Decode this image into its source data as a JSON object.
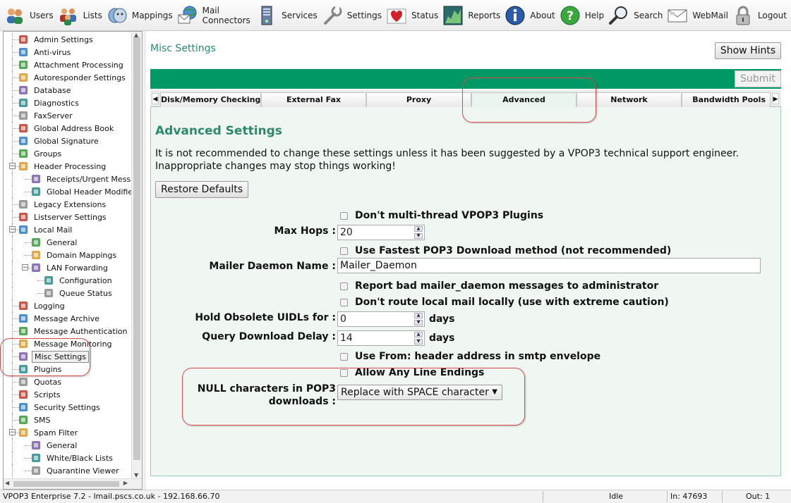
{
  "toolbar": {
    "items": [
      {
        "label": "Users",
        "icon": "users-icon"
      },
      {
        "label": "Lists",
        "icon": "lists-icon"
      },
      {
        "label": "Mappings",
        "icon": "mappings-icon"
      },
      {
        "label": "Mail Connectors",
        "icon": "mail-connectors-icon"
      },
      {
        "label": "Services",
        "icon": "services-icon"
      },
      {
        "label": "Settings",
        "icon": "settings-icon"
      },
      {
        "label": "Status",
        "icon": "status-icon"
      },
      {
        "label": "Reports",
        "icon": "reports-icon"
      },
      {
        "label": "About",
        "icon": "about-icon"
      },
      {
        "label": "Help",
        "icon": "help-icon"
      },
      {
        "label": "Search",
        "icon": "search-icon"
      },
      {
        "label": "WebMail",
        "icon": "webmail-icon"
      },
      {
        "label": "Logout",
        "icon": "logout-icon"
      }
    ]
  },
  "sidebar": {
    "items": [
      {
        "label": "Admin Settings",
        "icon": "admin-icon"
      },
      {
        "label": "Anti-virus",
        "icon": "shield-icon"
      },
      {
        "label": "Attachment Processing",
        "icon": "paperclip-icon"
      },
      {
        "label": "Autoresponder Settings",
        "icon": "autoresponder-icon"
      },
      {
        "label": "Database",
        "icon": "database-icon"
      },
      {
        "label": "Diagnostics",
        "icon": "diagnostics-icon"
      },
      {
        "label": "FaxServer",
        "icon": "fax-icon"
      },
      {
        "label": "Global Address Book",
        "icon": "address-book-icon"
      },
      {
        "label": "Global Signature",
        "icon": "signature-icon"
      },
      {
        "label": "Groups",
        "icon": "groups-icon"
      },
      {
        "label": "Header Processing",
        "icon": "header-icon"
      },
      {
        "label": "Receipts/Urgent Messages",
        "icon": "receipt-icon"
      },
      {
        "label": "Global Header Modifiers",
        "icon": "modifier-icon"
      },
      {
        "label": "Legacy Extensions",
        "icon": "puzzle-icon"
      },
      {
        "label": "Listserver Settings",
        "icon": "listserver-icon"
      },
      {
        "label": "Local Mail",
        "icon": "local-mail-icon"
      },
      {
        "label": "General",
        "icon": "gear-globe-icon"
      },
      {
        "label": "Domain Mappings",
        "icon": "globe-icon"
      },
      {
        "label": "LAN Forwarding",
        "icon": "lan-icon"
      },
      {
        "label": "Configuration",
        "icon": "config-icon"
      },
      {
        "label": "Queue Status",
        "icon": "queue-icon"
      },
      {
        "label": "Logging",
        "icon": "logging-icon"
      },
      {
        "label": "Message Archive",
        "icon": "archive-icon"
      },
      {
        "label": "Message Authentication",
        "icon": "auth-icon"
      },
      {
        "label": "Message Monitoring",
        "icon": "monitor-icon"
      },
      {
        "label": "Misc Settings",
        "icon": "wrench-icon"
      },
      {
        "label": "Plugins",
        "icon": "plugin-icon"
      },
      {
        "label": "Quotas",
        "icon": "quota-icon"
      },
      {
        "label": "Scripts",
        "icon": "script-icon"
      },
      {
        "label": "Security Settings",
        "icon": "security-icon"
      },
      {
        "label": "SMS",
        "icon": "phone-icon"
      },
      {
        "label": "Spam Filter",
        "icon": "spam-icon"
      },
      {
        "label": "General",
        "icon": "spam-general-icon"
      },
      {
        "label": "White/Black Lists",
        "icon": "list-edit-icon"
      },
      {
        "label": "Quarantine Viewer",
        "icon": "quarantine-icon"
      }
    ]
  },
  "main": {
    "title": "Misc Settings",
    "show_hints_label": "Show Hints",
    "submit_label": "Submit",
    "tabs": [
      "Disk/Memory Checking",
      "External Fax",
      "Proxy",
      "Advanced",
      "Network",
      "Bandwidth Pools"
    ],
    "active_tab": "Advanced",
    "heading": "Advanced Settings",
    "warning": "It is not recommended to change these settings unless it has been suggested by a VPOP3 technical support engineer. Inappropriate changes may stop things working!",
    "restore_label": "Restore Defaults",
    "form": {
      "no_multithread": "Don't multi-thread VPOP3 Plugins",
      "max_hops_label": "Max Hops :",
      "max_hops_value": "20",
      "fastest_pop3": "Use Fastest POP3 Download method (not recommended)",
      "mailer_daemon_label": "Mailer Daemon Name :",
      "mailer_daemon_value": "Mailer_Daemon",
      "report_bad_mailer": "Report bad mailer_daemon messages to administrator",
      "dont_route_local": "Don't route local mail locally (use with extreme caution)",
      "hold_uidls_label": "Hold Obsolete UIDLs for :",
      "hold_uidls_value": "0",
      "hold_uidls_unit": "days",
      "query_delay_label": "Query Download Delay :",
      "query_delay_value": "14",
      "query_delay_unit": "days",
      "use_from_header": "Use From: header address in smtp envelope",
      "allow_line_endings": "Allow Any Line Endings",
      "null_chars_label_1": "NULL characters in POP3",
      "null_chars_label_2": "downloads :",
      "null_chars_value": "Replace with SPACE character"
    }
  },
  "statusbar": {
    "info": "VPOP3 Enterprise 7.2 - lmail.pscs.co.uk - 192.168.66.70",
    "state": "Idle",
    "in": "In: 47693",
    "out": "Out: 1"
  },
  "colors": {
    "accent_green": "#009966",
    "heading_green": "#2b8a6b",
    "highlight_red": "#d94b4b"
  }
}
